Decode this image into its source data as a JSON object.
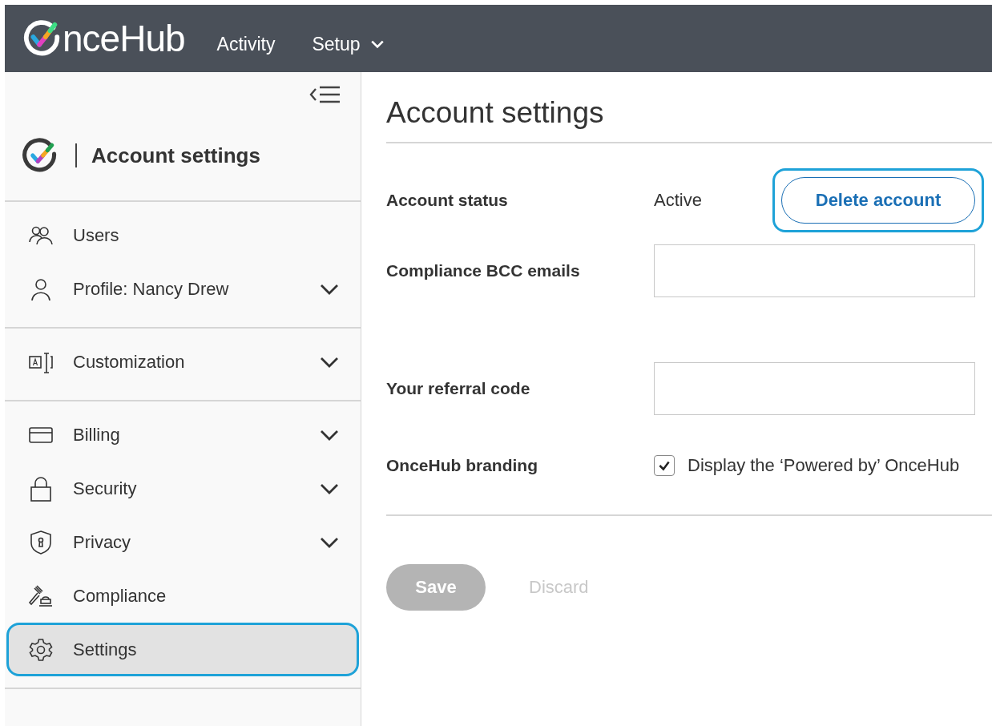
{
  "top_bar": {
    "logo": "nceHub",
    "nav": [
      {
        "label": "Activity",
        "has_menu": false
      },
      {
        "label": "Setup",
        "has_menu": true
      }
    ]
  },
  "sidebar": {
    "title": "Account settings",
    "groups": [
      {
        "items": [
          {
            "kind": "users",
            "label": "Users",
            "expandable": false,
            "selected": false
          },
          {
            "kind": "user",
            "label": "Profile: Nancy Drew",
            "expandable": true,
            "selected": false
          }
        ]
      },
      {
        "items": [
          {
            "kind": "customize",
            "label": "Customization",
            "expandable": true,
            "selected": false
          }
        ]
      },
      {
        "items": [
          {
            "kind": "card",
            "label": "Billing",
            "expandable": true,
            "selected": false
          },
          {
            "kind": "lock",
            "label": "Security",
            "expandable": true,
            "selected": false
          },
          {
            "kind": "shield",
            "label": "Privacy",
            "expandable": true,
            "selected": false
          },
          {
            "kind": "gavel",
            "label": "Compliance",
            "expandable": false,
            "selected": false
          },
          {
            "kind": "gear",
            "label": "Settings",
            "expandable": false,
            "selected": true
          }
        ]
      }
    ]
  },
  "page": {
    "title": "Account settings",
    "fields": [
      {
        "kind": "status",
        "label": "Account status",
        "value": "Active",
        "button": "Delete account"
      },
      {
        "kind": "input",
        "label": "Compliance BCC emails"
      },
      {
        "kind": "input",
        "label": "Your referral code"
      },
      {
        "kind": "checkbox",
        "label": "OnceHub branding",
        "option": "Display the ‘Powered by’ OnceHub",
        "checked": true
      }
    ],
    "buttons": [
      {
        "kind": "primary",
        "label": "Save",
        "disabled": true
      },
      {
        "kind": "link",
        "label": "Discard",
        "disabled": true
      }
    ]
  }
}
